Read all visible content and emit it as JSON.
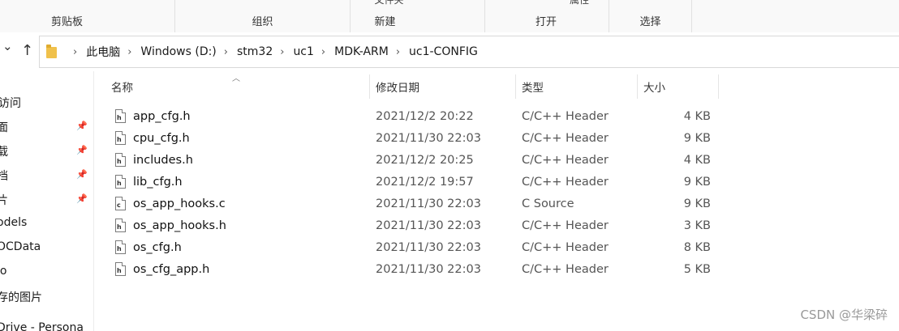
{
  "ribbon": {
    "groups": [
      {
        "label": "剪贴板",
        "clipped": ""
      },
      {
        "label": "组织",
        "clipped": ""
      },
      {
        "label": "新建",
        "clipped": "文件夹"
      },
      {
        "label": "打开",
        "clipped": "属性"
      },
      {
        "label": "选择",
        "clipped": ""
      }
    ]
  },
  "nav": {
    "back_glyph": "⌄",
    "up_glyph": "↑"
  },
  "breadcrumb": [
    "此电脑",
    "Windows (D:)",
    "stm32",
    "uc1",
    "MDK-ARM",
    "uc1-CONFIG"
  ],
  "breadcrumb_sep": "›",
  "columns": {
    "name": "名称",
    "date": "修改日期",
    "type": "类型",
    "size": "大小"
  },
  "sidebar": {
    "items": [
      {
        "label": "访问",
        "pinned": false
      },
      {
        "label": "面",
        "pinned": true
      },
      {
        "label": "载",
        "pinned": true
      },
      {
        "label": "档",
        "pinned": true
      },
      {
        "label": "片",
        "pinned": true
      },
      {
        "label": "odels",
        "pinned": false
      },
      {
        "label": "OCData",
        "pinned": false
      },
      {
        "label": "lo",
        "pinned": false
      },
      {
        "label": "存的图片",
        "pinned": false
      },
      {
        "label": "Drive - Persona",
        "pinned": false
      }
    ],
    "pin_icon": "📌"
  },
  "files": [
    {
      "name": "app_cfg.h",
      "date": "2021/12/2 20:22",
      "type": "C/C++ Header",
      "size": "4 KB",
      "icon": "h-file-icon"
    },
    {
      "name": "cpu_cfg.h",
      "date": "2021/11/30 22:03",
      "type": "C/C++ Header",
      "size": "9 KB",
      "icon": "h-file-icon"
    },
    {
      "name": "includes.h",
      "date": "2021/12/2 20:25",
      "type": "C/C++ Header",
      "size": "4 KB",
      "icon": "h-file-icon"
    },
    {
      "name": "lib_cfg.h",
      "date": "2021/12/2 19:57",
      "type": "C/C++ Header",
      "size": "9 KB",
      "icon": "h-file-icon"
    },
    {
      "name": "os_app_hooks.c",
      "date": "2021/11/30 22:03",
      "type": "C Source",
      "size": "9 KB",
      "icon": "c-file-icon"
    },
    {
      "name": "os_app_hooks.h",
      "date": "2021/11/30 22:03",
      "type": "C/C++ Header",
      "size": "3 KB",
      "icon": "h-file-icon"
    },
    {
      "name": "os_cfg.h",
      "date": "2021/11/30 22:03",
      "type": "C/C++ Header",
      "size": "8 KB",
      "icon": "h-file-icon"
    },
    {
      "name": "os_cfg_app.h",
      "date": "2021/11/30 22:03",
      "type": "C/C++ Header",
      "size": "5 KB",
      "icon": "h-file-icon"
    }
  ],
  "watermark": "CSDN @华梁碎"
}
